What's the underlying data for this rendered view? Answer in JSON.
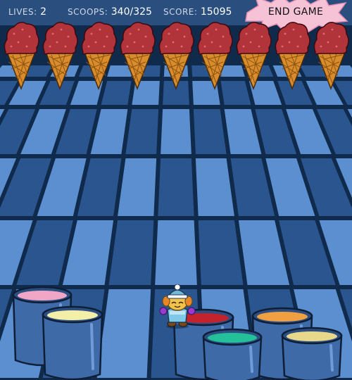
{
  "hud": {
    "lives_label": "LIVES:",
    "lives_value": "2",
    "scoops_label": "SCOOPS:",
    "scoops_value": "340/325",
    "score_label": "SCORE:",
    "score_value": "15095"
  },
  "end_game_label": "END GAME",
  "colors": {
    "hud_bg": "#2a4e7e",
    "floor_light": "#5c8fd0",
    "floor_dark": "#2a558f",
    "grout": "#102a4c",
    "cone": "#d98c2b",
    "scoop": "#b0343a"
  },
  "cones": [
    {
      "flavor": "strawberry"
    },
    {
      "flavor": "strawberry"
    },
    {
      "flavor": "strawberry"
    },
    {
      "flavor": "strawberry"
    },
    {
      "flavor": "strawberry"
    },
    {
      "flavor": "strawberry"
    },
    {
      "flavor": "strawberry"
    },
    {
      "flavor": "strawberry"
    },
    {
      "flavor": "strawberry"
    }
  ],
  "buckets": [
    {
      "flavor": "bubblegum",
      "color": "#f2a6c6"
    },
    {
      "flavor": "vanilla",
      "color": "#f4efa8"
    },
    {
      "flavor": "strawberry",
      "color": "#c2232d"
    },
    {
      "flavor": "orange",
      "color": "#f0a040"
    },
    {
      "flavor": "mint",
      "color": "#23c09a"
    },
    {
      "flavor": "banana",
      "color": "#e8d98a"
    }
  ],
  "player": {
    "character": "blue-hat-snowsuit-character"
  }
}
